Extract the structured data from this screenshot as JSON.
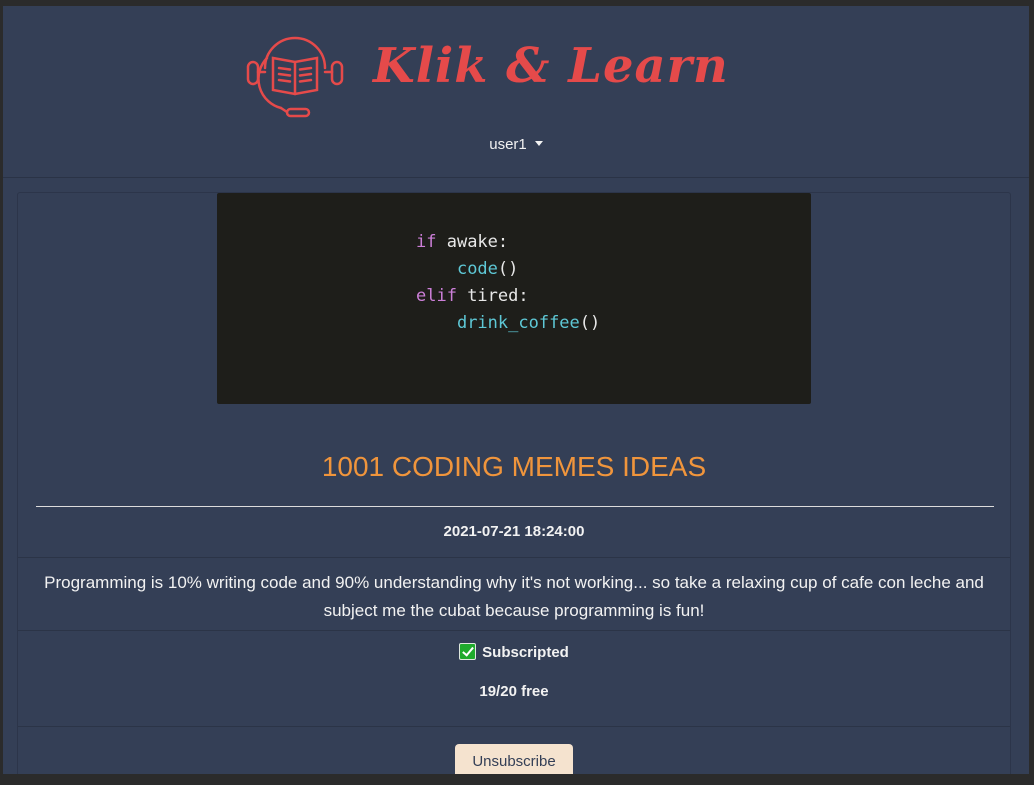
{
  "brand": {
    "name": "Klik & Learn",
    "logo_icon": "book-headset-icon"
  },
  "user_menu": {
    "label": "user1",
    "icon": "caret-down-icon"
  },
  "course": {
    "image_code": {
      "line1_kw": "if",
      "line1_rest": " awake:",
      "line2_fn": "code",
      "line2_rest": "()",
      "line3_kw": "elif",
      "line3_rest": " tired:",
      "line4_fn": "drink_coffee",
      "line4_rest": "()"
    },
    "title": "1001 CODING MEMES IDEAS",
    "datetime": "2021-07-21 18:24:00",
    "description": "Programming is 10% writing code and 90% understanding why it's not working... so take a relaxing cup of cafe con leche and subject me the cubat because programming is fun!",
    "subscription_status": "Subscripted",
    "availability": "19/20 free",
    "action_label": "Unsubscribe"
  },
  "colors": {
    "background": "#343f56",
    "brand": "#e54a4a",
    "title": "#f0953c",
    "button_bg": "#f5e3cf",
    "check": "#1faa2c"
  }
}
